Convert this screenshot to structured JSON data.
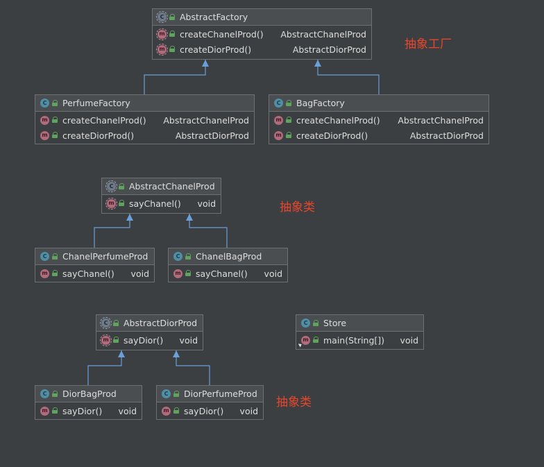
{
  "classes": {
    "abstract_factory": {
      "kind_letter": "C",
      "name": "AbstractFactory",
      "methods": [
        {
          "kind_letter": "m",
          "name": "createChanelProd()",
          "type": "AbstractChanelProd"
        },
        {
          "kind_letter": "m",
          "name": "createDiorProd()",
          "type": "AbstractDiorProd"
        }
      ]
    },
    "perfume_factory": {
      "kind_letter": "C",
      "name": "PerfumeFactory",
      "methods": [
        {
          "kind_letter": "m",
          "name": "createChanelProd()",
          "type": "AbstractChanelProd"
        },
        {
          "kind_letter": "m",
          "name": "createDiorProd()",
          "type": "AbstractDiorProd"
        }
      ]
    },
    "bag_factory": {
      "kind_letter": "C",
      "name": "BagFactory",
      "methods": [
        {
          "kind_letter": "m",
          "name": "createChanelProd()",
          "type": "AbstractChanelProd"
        },
        {
          "kind_letter": "m",
          "name": "createDiorProd()",
          "type": "AbstractDiorProd"
        }
      ]
    },
    "abstract_chanel_prod": {
      "kind_letter": "C",
      "name": "AbstractChanelProd",
      "methods": [
        {
          "kind_letter": "m",
          "name": "sayChanel()",
          "type": "void"
        }
      ]
    },
    "chanel_perfume_prod": {
      "kind_letter": "C",
      "name": "ChanelPerfumeProd",
      "methods": [
        {
          "kind_letter": "m",
          "name": "sayChanel()",
          "type": "void"
        }
      ]
    },
    "chanel_bag_prod": {
      "kind_letter": "C",
      "name": "ChanelBagProd",
      "methods": [
        {
          "kind_letter": "m",
          "name": "sayChanel()",
          "type": "void"
        }
      ]
    },
    "abstract_dior_prod": {
      "kind_letter": "C",
      "name": "AbstractDiorProd",
      "methods": [
        {
          "kind_letter": "m",
          "name": "sayDior()",
          "type": "void"
        }
      ]
    },
    "store": {
      "kind_letter": "C",
      "name": "Store",
      "methods": [
        {
          "kind_letter": "m",
          "name": "main(String[])",
          "type": "void"
        }
      ]
    },
    "dior_bag_prod": {
      "kind_letter": "C",
      "name": "DiorBagProd",
      "methods": [
        {
          "kind_letter": "m",
          "name": "sayDior()",
          "type": "void"
        }
      ]
    },
    "dior_perfume_prod": {
      "kind_letter": "C",
      "name": "DiorPerfumeProd",
      "methods": [
        {
          "kind_letter": "m",
          "name": "sayDior()",
          "type": "void"
        }
      ]
    }
  },
  "annotations": {
    "abstract_factory_note": "抽象工厂",
    "abstract_chanel_note": "抽象类",
    "abstract_dior_note": "抽象类"
  },
  "colors": {
    "background": "#3c3f41",
    "header": "#4b4e51",
    "border": "#6e7174",
    "edge": "#6a9fd8",
    "annotation": "#e8452c",
    "class_icon": "#4f8ea6",
    "method_icon": "#b06b7c",
    "visibility_icon": "#5fa35f"
  },
  "icons": {
    "class": "class-icon",
    "abstract_class": "abstract-class-icon",
    "method": "method-icon",
    "abstract_method": "abstract-method-icon",
    "visibility": "public-lock-icon",
    "main_runner": "run-main-icon"
  }
}
